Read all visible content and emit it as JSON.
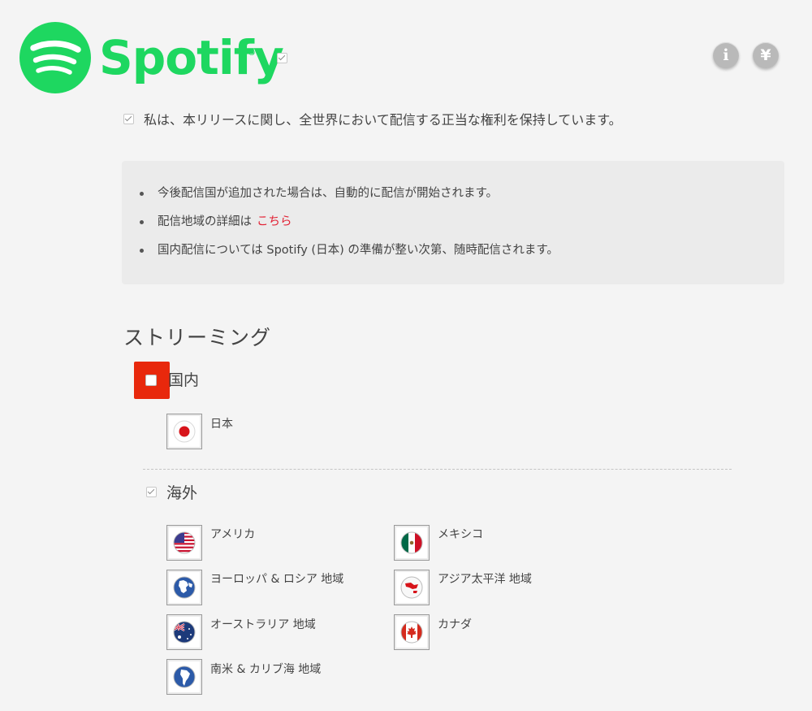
{
  "header": {
    "brand": "Spotify",
    "registered_mark": "®",
    "brand_checked": true,
    "info_icon": "info-icon",
    "yen_icon": "yen-icon",
    "info_glyph": "i",
    "yen_glyph": "¥",
    "brand_color": "#1ed760"
  },
  "rights": {
    "checked": true,
    "text": "私は、本リリースに関し、全世界において配信する正当な権利を保持しています。"
  },
  "notice": {
    "item1": "今後配信国が追加された場合は、自動的に配信が開始されます。",
    "item2_text": "配信地域の詳細は",
    "item2_link": "こちら",
    "item3": "国内配信については Spotify (日本) の準備が整い次第、随時配信されます。",
    "link_color": "#e22134"
  },
  "streaming": {
    "title": "ストリーミング",
    "domestic": {
      "label": "国内",
      "checked": false,
      "highlight_color": "#e8280c",
      "countries": [
        {
          "label": "日本",
          "icon": "japan-flag-icon"
        }
      ]
    },
    "overseas": {
      "label": "海外",
      "checked": true,
      "countries": [
        {
          "label": "アメリカ",
          "icon": "usa-flag-icon"
        },
        {
          "label": "メキシコ",
          "icon": "mexico-flag-icon"
        },
        {
          "label": "ヨーロッパ & ロシア 地域",
          "icon": "europe-russia-icon"
        },
        {
          "label": "アジア太平洋 地域",
          "icon": "asia-pacific-icon"
        },
        {
          "label": "オーストラリア 地域",
          "icon": "australia-flag-icon"
        },
        {
          "label": "カナダ",
          "icon": "canada-flag-icon"
        },
        {
          "label": "南米 & カリブ海 地域",
          "icon": "south-america-caribbean-icon"
        }
      ]
    }
  }
}
